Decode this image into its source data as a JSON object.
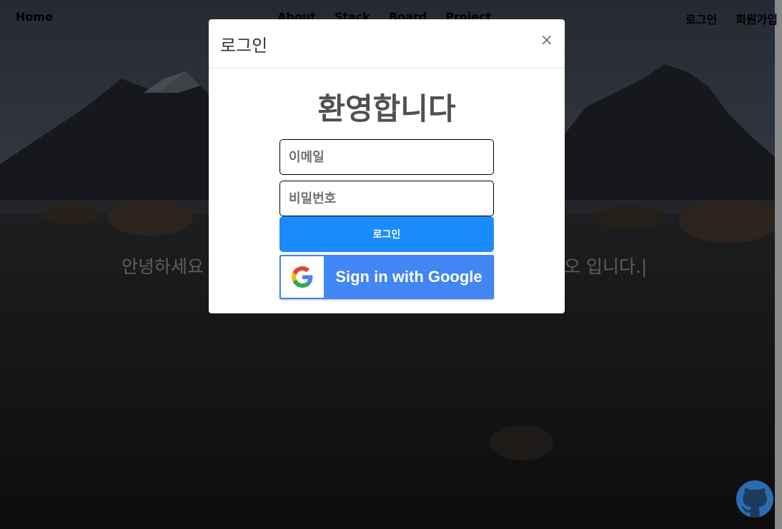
{
  "navbar": {
    "home": "Home",
    "links": [
      "About",
      "Stack",
      "Board",
      "Project"
    ],
    "login": "로그인",
    "signup": "회원가입"
  },
  "hero": {
    "text_left": "안녕하세요",
    "text_right": "오 입니다.|"
  },
  "modal": {
    "title": "로그인",
    "close": "×",
    "welcome": "환영합니다",
    "email_placeholder": "이메일",
    "password_placeholder": "비밀번호",
    "login_button": "로그인",
    "google_button": "Sign in with Google"
  },
  "icons": {
    "close": "close-icon",
    "google": "google-logo-icon",
    "github": "github-icon"
  },
  "colors": {
    "login_button": "#1a8cff",
    "google_button": "#4285f4",
    "overlay": "rgba(0,0,0,0.5)",
    "scrollbar": "#8a8a8a"
  }
}
